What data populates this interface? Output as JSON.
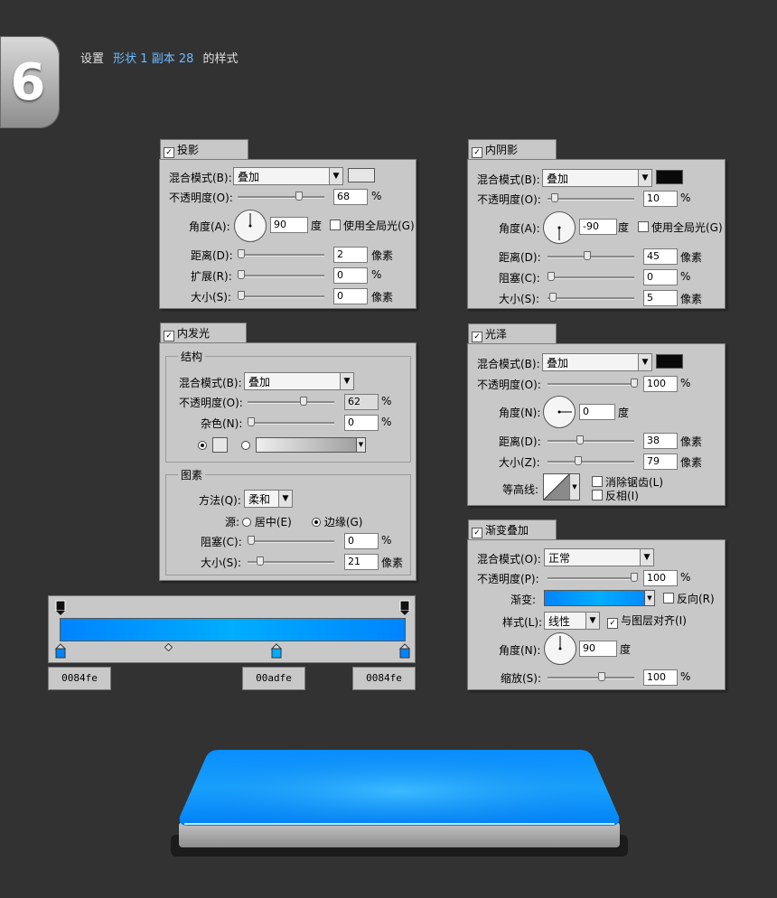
{
  "step": {
    "number": "6"
  },
  "heading": {
    "prefix": "设置",
    "layer_name": "形状 1 副本 28",
    "suffix": "的样式"
  },
  "colors": {
    "accent": "#6fb9ff",
    "panel": "#c8c8c8",
    "background": "#323232",
    "gradient_start": "#0084fe",
    "gradient_mid": "#00adfe",
    "gradient_end": "#0084fe"
  },
  "drop_shadow": {
    "title": "投影",
    "checked": true,
    "blend_label": "混合模式(B):",
    "blend_value": "叠加",
    "color": "#e6e6e6",
    "opacity_label": "不透明度(O):",
    "opacity": "68",
    "opacity_unit": "%",
    "angle_label": "角度(A):",
    "angle": "90",
    "angle_unit": "度",
    "global_light": "使用全局光(G)",
    "distance_label": "距离(D):",
    "distance": "2",
    "distance_unit": "像素",
    "spread_label": "扩展(R):",
    "spread": "0",
    "spread_unit": "%",
    "size_label": "大小(S):",
    "size": "0",
    "size_unit": "像素"
  },
  "inner_shadow": {
    "title": "内阴影",
    "checked": true,
    "blend_label": "混合模式(B):",
    "blend_value": "叠加",
    "color": "#0a0a0a",
    "opacity_label": "不透明度(O):",
    "opacity": "10",
    "opacity_unit": "%",
    "angle_label": "角度(A):",
    "angle": "-90",
    "angle_unit": "度",
    "global_light": "使用全局光(G)",
    "distance_label": "距离(D):",
    "distance": "45",
    "distance_unit": "像素",
    "choke_label": "阻塞(C):",
    "choke": "0",
    "choke_unit": "%",
    "size_label": "大小(S):",
    "size": "5",
    "size_unit": "像素"
  },
  "inner_glow": {
    "title": "内发光",
    "checked": true,
    "structure_title": "结构",
    "blend_label": "混合模式(B):",
    "blend_value": "叠加",
    "opacity_label": "不透明度(O):",
    "opacity": "62",
    "opacity_unit": "%",
    "noise_label": "杂色(N):",
    "noise": "0",
    "noise_unit": "%",
    "elements_title": "图素",
    "technique_label": "方法(Q):",
    "technique": "柔和",
    "source_label": "源:",
    "source_center": "居中(E)",
    "source_edge": "边缘(G)",
    "choke_label": "阻塞(C):",
    "choke": "0",
    "choke_unit": "%",
    "size_label": "大小(S):",
    "size": "21",
    "size_unit": "像素"
  },
  "satin": {
    "title": "光泽",
    "checked": true,
    "blend_label": "混合模式(B):",
    "blend_value": "叠加",
    "color": "#0a0a0a",
    "opacity_label": "不透明度(O):",
    "opacity": "100",
    "opacity_unit": "%",
    "angle_label": "角度(N):",
    "angle": "0",
    "angle_unit": "度",
    "distance_label": "距离(D):",
    "distance": "38",
    "distance_unit": "像素",
    "size_label": "大小(Z):",
    "size": "79",
    "size_unit": "像素",
    "contour_label": "等高线:",
    "antialias": "消除锯齿(L)",
    "invert": "反相(I)"
  },
  "gradient_overlay": {
    "title": "渐变叠加",
    "checked": true,
    "blend_label": "混合模式(O):",
    "blend_value": "正常",
    "opacity_label": "不透明度(P):",
    "opacity": "100",
    "opacity_unit": "%",
    "gradient_label": "渐变:",
    "reverse": "反向(R)",
    "style_label": "样式(L):",
    "style_value": "线性",
    "align": "与图层对齐(I)",
    "align_checked": true,
    "angle_label": "角度(N):",
    "angle": "90",
    "angle_unit": "度",
    "scale_label": "缩放(S):",
    "scale": "100",
    "scale_unit": "%"
  },
  "gradient_stops": [
    "0084fe",
    "00adfe",
    "0084fe"
  ]
}
